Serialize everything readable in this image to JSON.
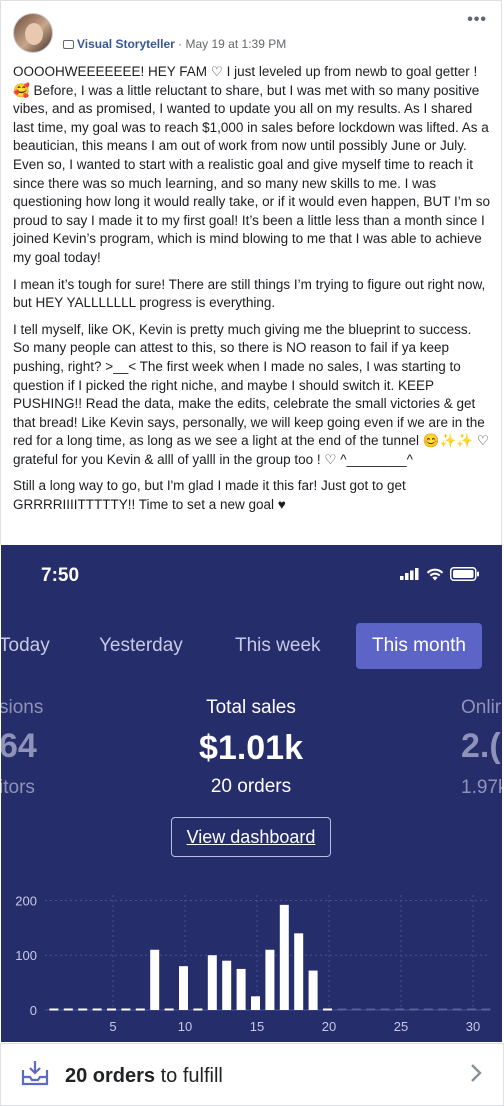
{
  "post": {
    "author": "Visual Storyteller",
    "separator": " · ",
    "date": "May 19 at 1:39 PM",
    "more": "•••",
    "paragraphs": [
      "OOOOHWEEEEEEE! HEY FAM ♡ I just leveled up from newb to goal getter ! 🥰 Before, I was a little reluctant to share, but I was met with so many positive vibes, and as promised, I wanted to update you all on my results. As I shared last time, my goal was to reach $1,000 in sales before lockdown was lifted. As a beautician, this means I am out of work from now until possibly June or July. Even so, I wanted to start with a realistic goal and give myself time to reach it since there was so much learning, and so many new skills to me. I was questioning how long it would really take, or if it would even happen, BUT I’m so proud to say I made it to my first goal! It’s been a little less than a month since I joined Kevin’s program, which is mind blowing to me that I was able to achieve my goal today!",
      "I mean it’s tough for sure! There are still things I’m trying to figure out right now, but HEY YALLLLLLL progress is everything.",
      "I tell myself, like OK, Kevin is pretty much giving me the blueprint to success. So many people can attest to this, so there is NO reason to fail if ya keep pushing, right? >__< The first week when I made no sales, I was starting to question if I picked the right niche, and maybe I should switch it. KEEP PUSHING!! Read the data, make the edits, celebrate the small victories & get that bread! Like Kevin says, personally, we will keep going even if we are in the red for a long time, as long as we see a light at the end of the tunnel 😊✨✨ ♡ grateful for you Kevin & alll of yalll in the group too ! ♡ ^________^",
      "Still a long way to go, but I'm glad I made it this far! Just got to get GRRRRIIIITTTTTY!! Time to set a new goal ♥"
    ]
  },
  "phone": {
    "time": "7:50",
    "tabs": [
      "Today",
      "Yesterday",
      "This week",
      "This month"
    ],
    "active_tab": "This month",
    "left_partial": {
      "label": "sions",
      "value": "64",
      "sub": "itors"
    },
    "main_metric": {
      "label": "Total sales",
      "value": "$1.01k",
      "sub": "20 orders"
    },
    "right_partial": {
      "label": "Onlir",
      "value": "2.(",
      "sub": "1.97k"
    },
    "dashboard_button": "View dashboard",
    "colors": {
      "background": "#262d6b",
      "active_tab": "#5d64c8",
      "bars": "#ffffff",
      "grid": "#4a5099"
    }
  },
  "chart_data": {
    "type": "bar",
    "x": [
      1,
      2,
      3,
      4,
      5,
      6,
      7,
      8,
      9,
      10,
      11,
      12,
      13,
      14,
      15,
      16,
      17,
      18,
      19,
      20,
      21,
      22,
      23,
      24,
      25,
      26,
      27,
      28,
      29,
      30,
      31
    ],
    "values": [
      0,
      0,
      0,
      0,
      0,
      0,
      0,
      110,
      0,
      80,
      0,
      100,
      90,
      75,
      25,
      110,
      192,
      140,
      72,
      0,
      0,
      0,
      0,
      0,
      0,
      0,
      0,
      0,
      0,
      0,
      0
    ],
    "ylim": [
      0,
      210
    ],
    "yticks": [
      0,
      100,
      200
    ],
    "xticks": [
      5,
      10,
      15,
      20,
      25,
      30
    ],
    "grid": true
  },
  "footer": {
    "count": "20 orders",
    "rest": " to fulfill"
  }
}
